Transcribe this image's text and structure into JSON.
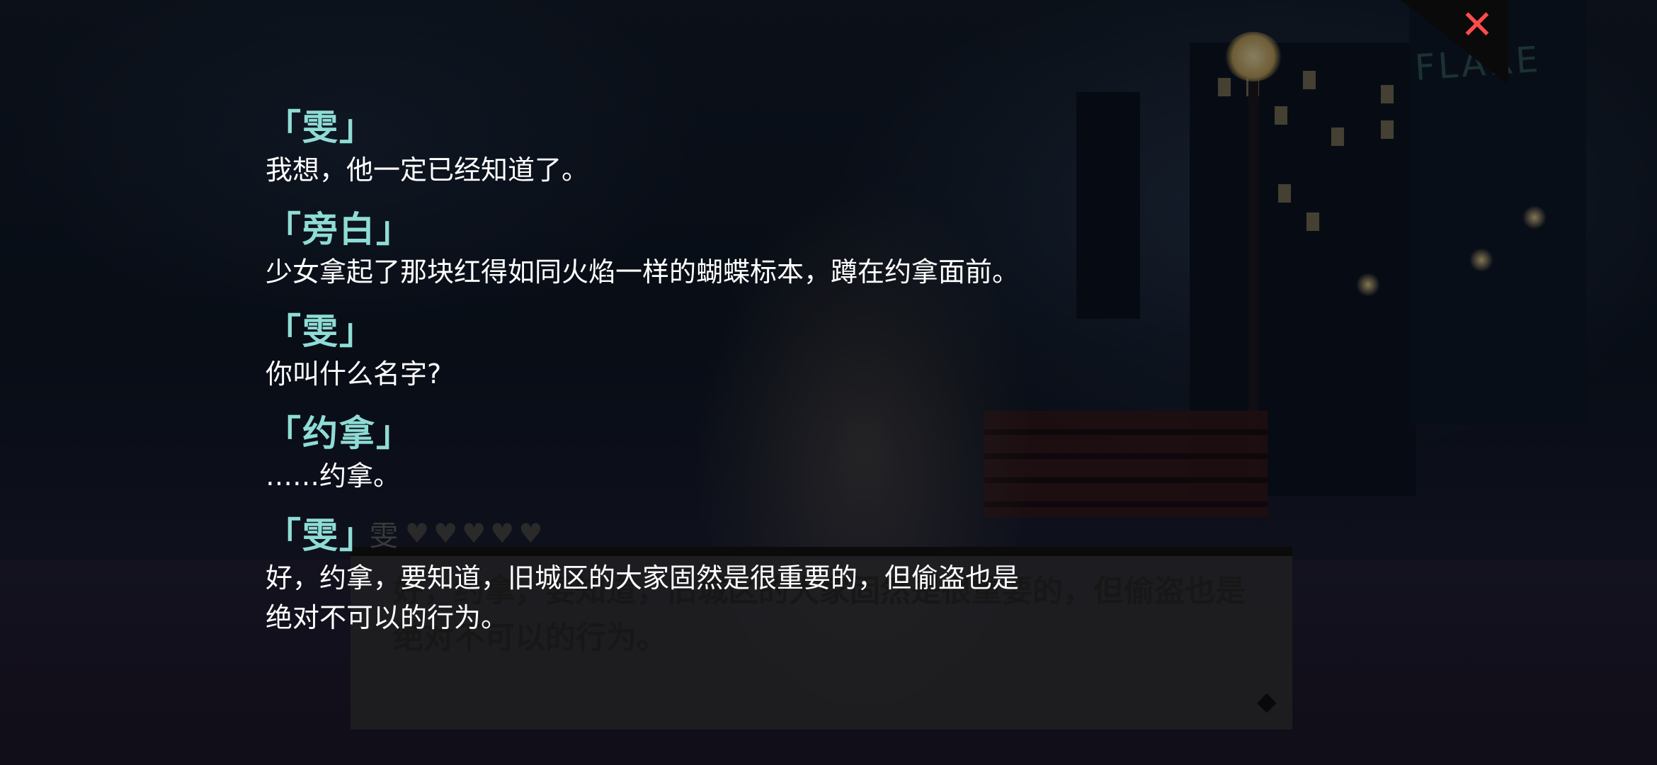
{
  "backlog": [
    {
      "speaker": "「雯」",
      "text": "我想，他一定已经知道了。"
    },
    {
      "speaker": "「旁白」",
      "text": "少女拿起了那块红得如同火焰一样的蝴蝶标本，蹲在约拿面前。"
    },
    {
      "speaker": "「雯」",
      "text": "你叫什么名字?"
    },
    {
      "speaker": "「约拿」",
      "text": "……约拿。"
    },
    {
      "speaker": "「雯」",
      "text_line1": "好，约拿，要知道，旧城区的大家固然是很重要的，但偷盗也是",
      "text_line2": "绝对不可以的行为。"
    }
  ],
  "dialog": {
    "name": "雯",
    "text": "好，约拿，要知道，旧城区的大家固然是很重要的，但偷盗也是绝对不可以的行为。",
    "hearts": 5,
    "next_icon": "diamond-icon"
  },
  "scene": {
    "sign_text": "FLARE"
  },
  "close_button": {
    "icon": "close-icon",
    "glyph": "✕",
    "color": "#ff4b4b"
  },
  "colors": {
    "speaker": "#8fdcd6",
    "line": "#ffffff"
  }
}
